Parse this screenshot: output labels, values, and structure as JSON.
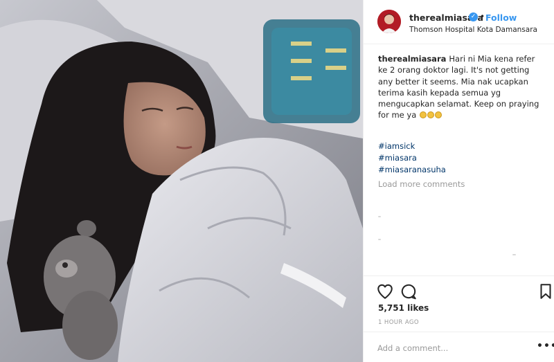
{
  "post": {
    "username": "therealmiasara",
    "follow_label": "Follow",
    "separator": "•",
    "location": "Thomson Hospital Kota Damansara"
  },
  "caption": {
    "username": "therealmiasara",
    "text": "Hari ni Mia kena refer ke 2 orang doktor lagi. It's not getting any better it seems. Mia nak ucapkan terima kasih kepada semua yg mengucapkan selamat. Keep on praying for me ya",
    "emoji_count": 3
  },
  "hashtags": [
    "#iamsick",
    "#miasara",
    "#miasaranasuha"
  ],
  "comments": {
    "load_more_label": "Load more comments"
  },
  "actions": {
    "likes": "5,751 likes",
    "timestamp": "1 HOUR AGO"
  },
  "comment_box": {
    "placeholder": "Add a comment...",
    "more_label": "•••"
  },
  "colors": {
    "accent": "#3897f0",
    "hashtag": "#003569",
    "muted": "#999999",
    "text": "#262626"
  },
  "icons": [
    "verified-badge-icon",
    "heart-icon",
    "comment-icon",
    "bookmark-icon",
    "more-options-icon"
  ]
}
